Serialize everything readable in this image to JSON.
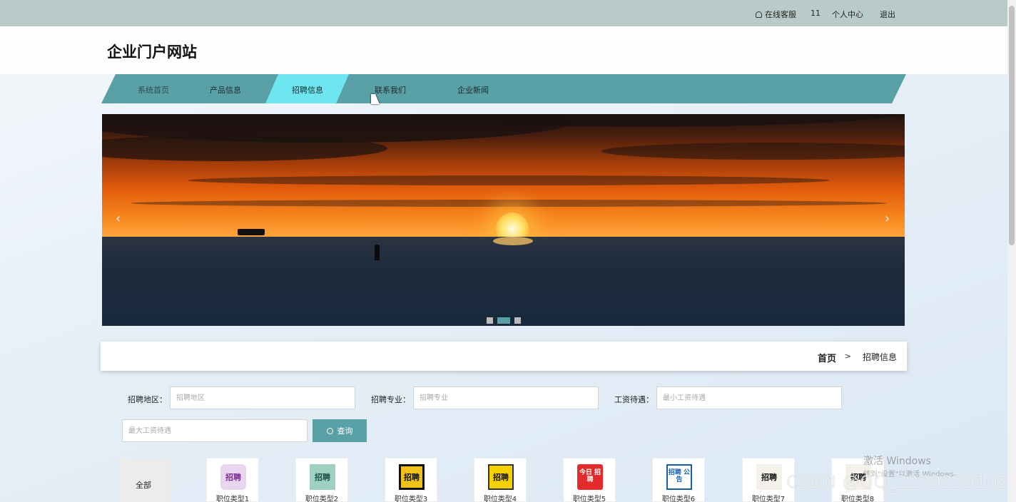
{
  "topbar": {
    "service": "在线客服",
    "user": "11",
    "profile": "个人中心",
    "logout": "退出"
  },
  "header": {
    "title": "企业门户网站"
  },
  "nav": {
    "items": [
      "系统首页",
      "产品信息",
      "招聘信息",
      "联系我们",
      "企业新闻"
    ],
    "active": "招聘信息"
  },
  "carousel": {
    "prev": "‹",
    "next": "›",
    "slide_count": 3,
    "active_slide": 2
  },
  "breadcrumb": {
    "home": "首页",
    "separator": ">",
    "current": "招聘信息"
  },
  "search": {
    "region_label": "招聘地区：",
    "region_placeholder": "招聘地区",
    "major_label": "招聘专业：",
    "major_placeholder": "招聘专业",
    "salary_label": "工资待遇：",
    "salary_min_placeholder": "最小工资待遇",
    "salary_max_placeholder": "最大工资待遇",
    "button": "查询"
  },
  "categories": {
    "all": "全部",
    "items": [
      "职位类型1",
      "职位类型2",
      "职位类型3",
      "职位类型4",
      "职位类型5",
      "职位类型6",
      "职位类型7",
      "职位类型8"
    ],
    "thumb_text": [
      "招聘",
      "招聘",
      "招聘",
      "招聘",
      "今日 招聘",
      "招聘 公告",
      "招聘",
      "招聘"
    ]
  },
  "watermark": {
    "windows_title": "激活 Windows",
    "windows_sub": "转到\"设置\"以激活 Windows。",
    "csdn": "CSDN @QQ_2279239102"
  },
  "colors": {
    "accent": "#5aa0a7",
    "nav_active": "#6de6ef",
    "topbar": "#b9cbc8"
  }
}
